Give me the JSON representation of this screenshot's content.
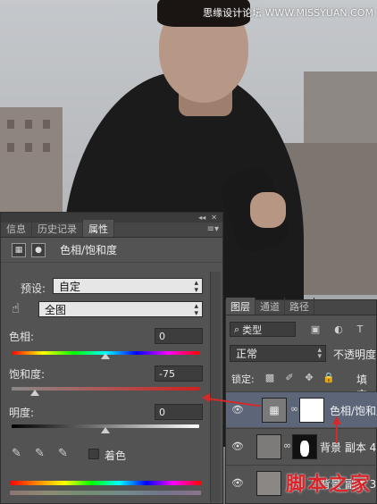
{
  "watermarks": {
    "top": "思缘设计论坛 WWW.MISSYUAN.COM",
    "bottom": "脚本之家"
  },
  "properties_panel": {
    "tabs": [
      {
        "label": "信息"
      },
      {
        "label": "历史记录"
      },
      {
        "label": "属性"
      }
    ],
    "header_title": "色相/饱和度",
    "preset_label": "预设:",
    "preset_value": "自定",
    "channel_value": "全图",
    "hue": {
      "label": "色相:",
      "value": "0"
    },
    "saturation": {
      "label": "饱和度:",
      "value": "-75"
    },
    "lightness": {
      "label": "明度:",
      "value": "0"
    },
    "colorize_label": "着色"
  },
  "layers_panel": {
    "tabs": [
      {
        "label": "图层"
      },
      {
        "label": "通道"
      },
      {
        "label": "路径"
      }
    ],
    "filter_value": "类型",
    "blend_mode": "正常",
    "opacity_label": "不透明度",
    "lock_label": "锁定:",
    "fill_label": "填充",
    "layers": [
      {
        "name": "色相/饱和度"
      },
      {
        "name": "背景 副本 4"
      },
      {
        "name": "背景 副本 3"
      }
    ]
  },
  "colors": {
    "accent_red": "#d42a2a",
    "selected_layer": "#5c6678",
    "panel_bg": "#535353"
  },
  "icons": [
    "hue-saturation-icon",
    "mask-icon",
    "hand-tool-icon",
    "eyedropper-icon",
    "eyedropper-plus-icon",
    "eyedropper-minus-icon",
    "eye-icon",
    "link-icon",
    "lock-icon"
  ]
}
